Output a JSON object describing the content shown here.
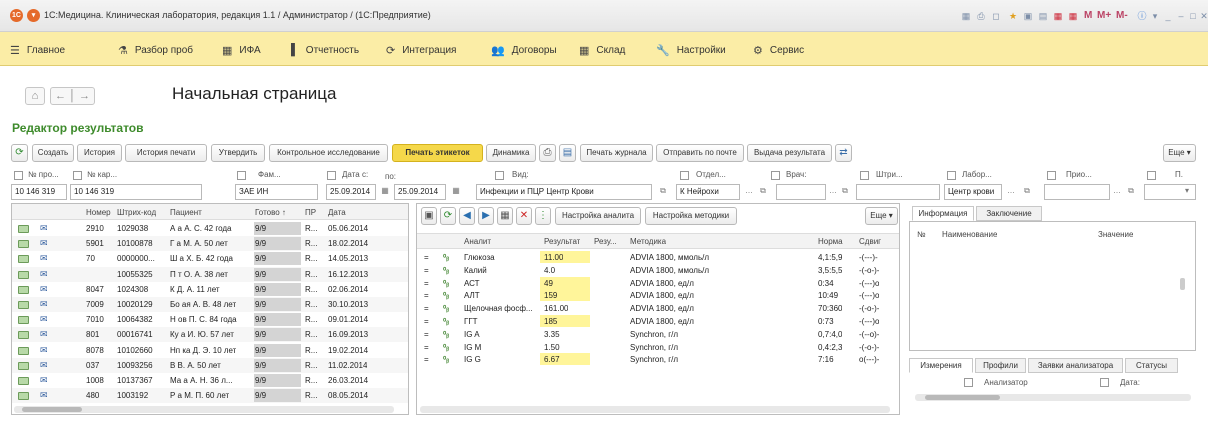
{
  "window": {
    "title": "1С:Медицина. Клиническая лаборатория, редакция 1.1 / Администратор / (1С:Предприятие)",
    "logo": "1С",
    "right_tools": [
      "М",
      "М+",
      "М-"
    ]
  },
  "menu": [
    "Главное",
    "Разбор проб",
    "ИФА",
    "Отчетность",
    "Интеграция",
    "Договоры",
    "Склад",
    "Настройки",
    "Сервис"
  ],
  "page_title": "Начальная страница",
  "editor_title": "Редактор результатов",
  "toolbar": {
    "buttons": [
      "Создать",
      "История",
      "История печати",
      "Утвердить",
      "Контрольное исследование",
      "Печать этикеток",
      "Динамика",
      "Печать журнала",
      "Отправить по почте",
      "Выдача результата"
    ],
    "more": "Еще ▾"
  },
  "filters": {
    "labels": [
      "№ про...",
      "№ кар...",
      "Фам...",
      "Дата с:",
      "по:",
      "Вид:",
      "Отдел...",
      "Врач:",
      "Штри...",
      "Лабор...",
      "Прио...",
      "П."
    ],
    "values": {
      "num_pro": "10 146 319",
      "num_kar": "10 146 319",
      "fam": "ЗАЕ      ИН",
      "date_from": "25.09.2014",
      "date_to": "25.09.2014",
      "vid": "Инфекции и ПЦР Центр Крови",
      "otdel": "К      Нейрохи",
      "labor": "Центр крови"
    }
  },
  "patients": {
    "headers": [
      "Номер",
      "Штрих-код",
      "Пациент",
      "Готово ↑",
      "ПР",
      "Дата"
    ],
    "rows": [
      [
        "2910",
        "1029038",
        "А            а А. С.  42 года",
        "9/9",
        "R...",
        "05.06.2014"
      ],
      [
        "5901",
        "10100878",
        "Г            а М. А.  50 лет",
        "9/9",
        "R...",
        "18.02.2014"
      ],
      [
        "70",
        "0000000...",
        "Ш            а Х. Б.  42 года",
        "9/9",
        "R...",
        "14.05.2013"
      ],
      [
        "",
        "10055325",
        "П            т О. А.  38 лет",
        "9/9",
        "R...",
        "16.12.2013"
      ],
      [
        "8047",
        "1024308",
        "К            Д. А.  11 лет",
        "9/9",
        "R...",
        "02.06.2014"
      ],
      [
        "7009",
        "10020129",
        "Бо           ая А. В.  48 лет",
        "9/9",
        "R...",
        "30.10.2013"
      ],
      [
        "7010",
        "10064382",
        "Н            ов П. С.  84 года",
        "9/9",
        "R...",
        "09.01.2014"
      ],
      [
        "801",
        "00016741",
        "Ку           а И. Ю.  57 лет",
        "9/9",
        "R...",
        "16.09.2013"
      ],
      [
        "8078",
        "10102660",
        "Нп           ка Д. Э.  10 лет",
        "9/9",
        "R...",
        "19.02.2014"
      ],
      [
        "037",
        "10093256",
        "В            В. А.  50 лет",
        "9/9",
        "R...",
        "11.02.2014"
      ],
      [
        "1008",
        "10137367",
        "Ма           а А. Н.  36 л...",
        "9/9",
        "R...",
        "26.03.2014"
      ],
      [
        "480",
        "1003192",
        "Р            а М. П.  60 лет",
        "9/9",
        "R...",
        "08.05.2014"
      ]
    ]
  },
  "analytes_toolbar": {
    "setup_analyte": "Настройка аналита",
    "setup_method": "Настройка методики",
    "more": "Еще ▾"
  },
  "analytes": {
    "headers": [
      "Аналит",
      "Результат",
      "Резу...",
      "Методика",
      "Норма",
      "Сдвиг"
    ],
    "rows": [
      [
        "=",
        "Глюкоза",
        "11.00",
        "ADVIA 1800, ммоль/л",
        "4,1:5,9",
        "-(---)-"
      ],
      [
        "=",
        "Калий",
        "4.0",
        "ADVIA 1800, ммоль/л",
        "3,5:5,5",
        "-(-o-)-"
      ],
      [
        "=",
        "АСТ",
        "49",
        "ADVIA 1800, ед/л",
        "0:34",
        "-(---)o"
      ],
      [
        "=",
        "АЛТ",
        "159",
        "ADVIA 1800, ед/л",
        "10:49",
        "-(---)o"
      ],
      [
        "=",
        "Щелочная фосф...",
        "161.00",
        "ADVIA 1800, ед/л",
        "70:360",
        "-(-o-)-"
      ],
      [
        "=",
        "ГГТ",
        "185",
        "ADVIA 1800, ед/л",
        "0:73",
        "-(---)o"
      ],
      [
        "=",
        "IG A",
        "3.35",
        "Synchron, г/л",
        "0,7:4,0",
        "-(--o)-"
      ],
      [
        "=",
        "IG M",
        "1.50",
        "Synchron, г/л",
        "0,4:2,3",
        "-(-o-)-"
      ],
      [
        "=",
        "IG G",
        "6.67",
        "Synchron, г/л",
        "7:16",
        "o(---)-"
      ]
    ]
  },
  "info": {
    "tabs": [
      "Информация",
      "Заключение"
    ],
    "headers": [
      "№",
      "Наименование",
      "Значение"
    ],
    "bottom_tabs": [
      "Измерения",
      "Профили",
      "Заявки анализатора",
      "Статусы"
    ],
    "analyzer_label": "Анализатор",
    "date_label": "Дата:"
  }
}
